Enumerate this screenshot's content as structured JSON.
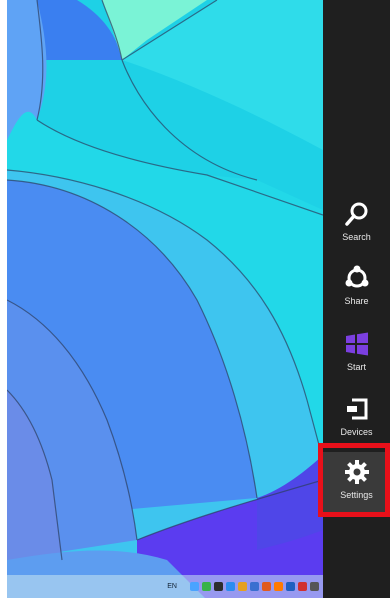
{
  "charms": [
    {
      "label": "Search",
      "icon": "search-icon"
    },
    {
      "label": "Share",
      "icon": "share-icon"
    },
    {
      "label": "Start",
      "icon": "windows-logo-icon"
    },
    {
      "label": "Devices",
      "icon": "devices-icon"
    },
    {
      "label": "Settings",
      "icon": "gear-icon"
    }
  ],
  "taskbar": {
    "language": "EN"
  },
  "colors": {
    "charms_bg": "#1f1f1f",
    "windows_logo": "#7b3fe0",
    "highlight": "#e8101a",
    "wallpaper_cyan": "#1ed1e6",
    "wallpaper_blue": "#4f7ff0"
  }
}
